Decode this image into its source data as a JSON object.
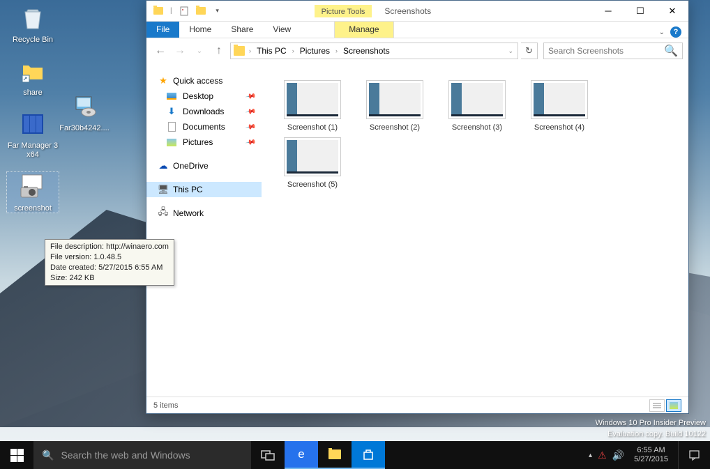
{
  "desktop_icons": [
    {
      "label": "Recycle Bin",
      "name": "recycle-bin"
    },
    {
      "label": "share",
      "name": "share-folder"
    },
    {
      "label": "Far Manager 3 x64",
      "name": "far-manager"
    },
    {
      "label": "screenshot",
      "name": "screenshot-exe",
      "selected": true
    }
  ],
  "desktop_icons_col2": [
    {
      "label": "Far30b4242....",
      "name": "far-installer"
    }
  ],
  "tooltip": {
    "l1": "File description: http://winaero.com",
    "l2": "File version: 1.0.48.5",
    "l3": "Date created: 5/27/2015 6:55 AM",
    "l4": "Size: 242 KB"
  },
  "window": {
    "context_tab_label": "Picture Tools",
    "title": "Screenshots",
    "ribbon": {
      "file": "File",
      "home": "Home",
      "share": "Share",
      "view": "View",
      "manage": "Manage"
    },
    "breadcrumb": [
      "This PC",
      "Pictures",
      "Screenshots"
    ],
    "search_placeholder": "Search Screenshots",
    "nav_pane": {
      "quick_access": "Quick access",
      "qa_items": [
        {
          "label": "Desktop",
          "icon": "desktop"
        },
        {
          "label": "Downloads",
          "icon": "dl"
        },
        {
          "label": "Documents",
          "icon": "doc"
        },
        {
          "label": "Pictures",
          "icon": "pic"
        }
      ],
      "onedrive": "OneDrive",
      "this_pc": "This PC",
      "network": "Network"
    },
    "files": [
      {
        "label": "Screenshot (1)"
      },
      {
        "label": "Screenshot (2)"
      },
      {
        "label": "Screenshot (3)"
      },
      {
        "label": "Screenshot (4)"
      },
      {
        "label": "Screenshot (5)"
      }
    ],
    "status": "5 items"
  },
  "watermark": {
    "line1": "Windows 10 Pro Insider Preview",
    "line2": "Evaluation copy. Build 10122"
  },
  "taskbar": {
    "search_placeholder": "Search the web and Windows",
    "time": "6:55 AM",
    "date": "5/27/2015"
  }
}
